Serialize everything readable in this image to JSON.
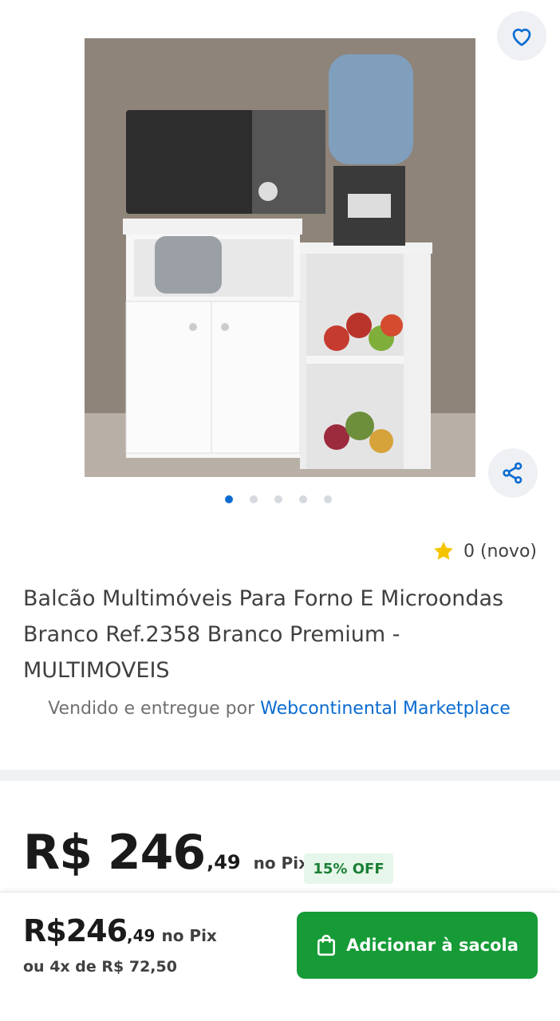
{
  "product": {
    "rating_text": "0 (novo)",
    "title": "Balcão Multimóveis Para Forno E Microondas Branco Ref.2358 Branco Premium - MULTIMOVEIS",
    "seller_prefix": "Vendido e entregue por",
    "seller_name": "Webcontinental Marketplace",
    "images_count": 5,
    "active_image": 1
  },
  "price": {
    "main": "R$ 246",
    "cents": ",49",
    "pix_label": "no Pix",
    "discount_badge": "15% OFF"
  },
  "bottom_bar": {
    "price_main": "R$246",
    "price_cents": ",49",
    "pix_label": "no Pix",
    "installments": "ou 4x de R$ 72,50",
    "add_button": "Adicionar à sacola"
  },
  "icons": {
    "favorite": "heart-icon",
    "share": "share-icon",
    "rating": "star-icon",
    "bag": "shopping-bag-icon"
  },
  "colors": {
    "accent_blue": "#0a6bd1",
    "button_green": "#169b37",
    "star": "#f5c400",
    "badge_bg": "#e6f6ea",
    "badge_text": "#1a7f35"
  }
}
